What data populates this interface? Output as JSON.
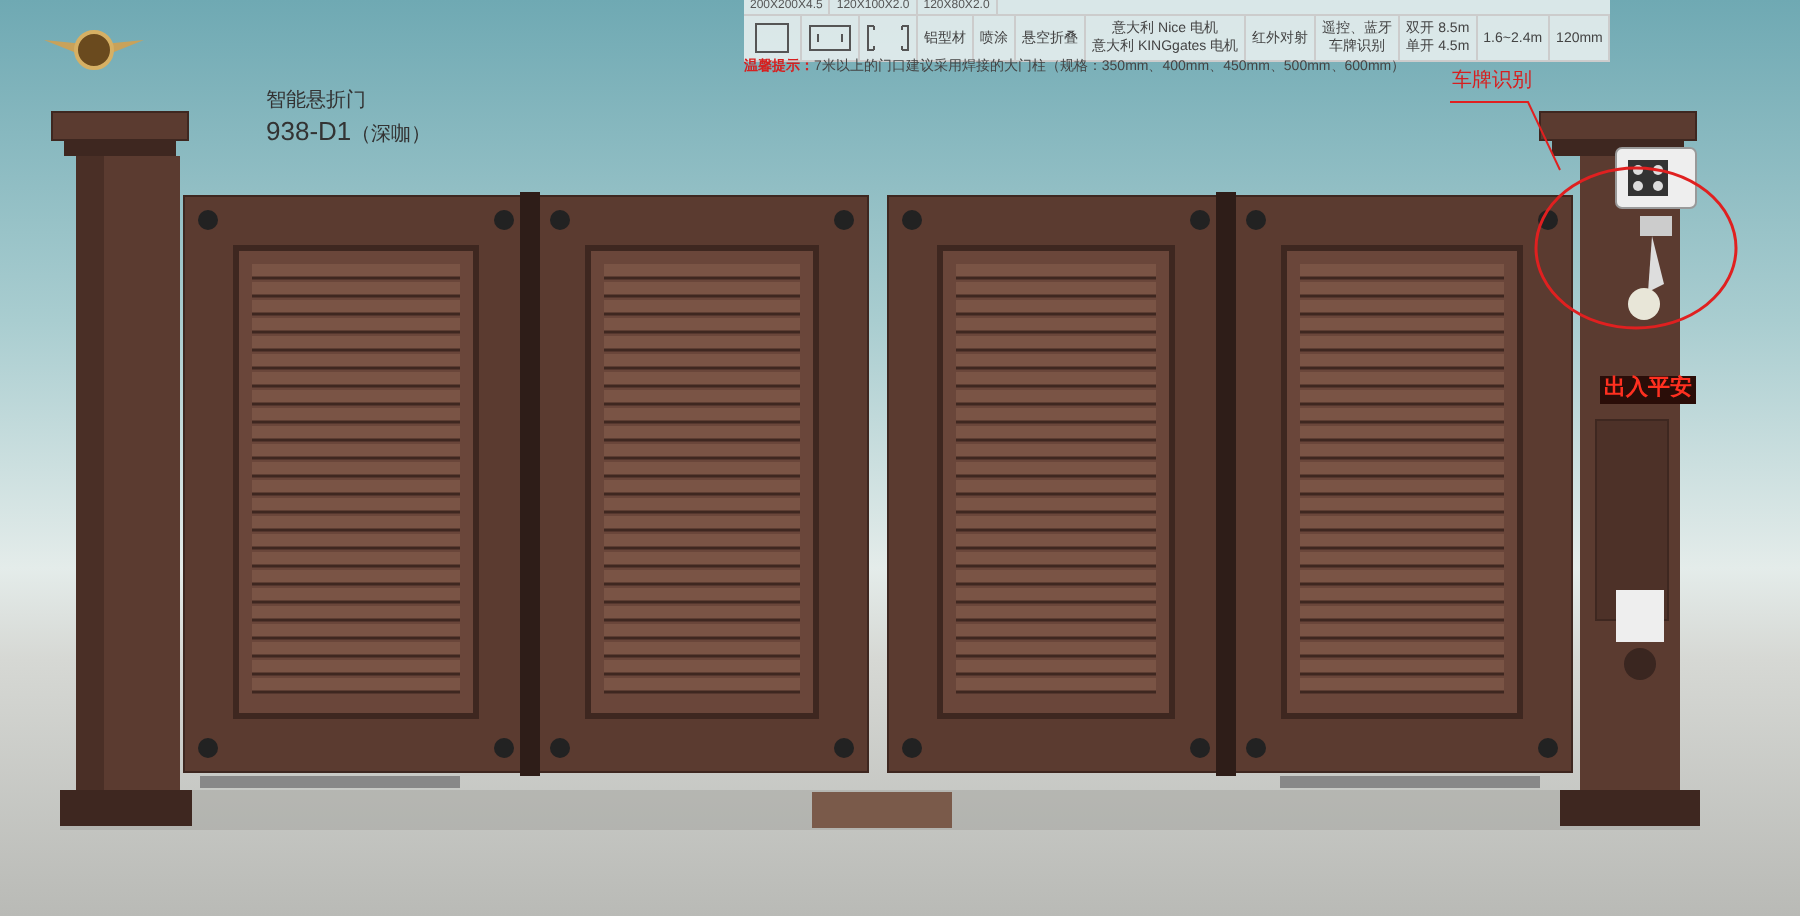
{
  "product": {
    "name": "智能悬折门",
    "model": "938-D1",
    "color_note": "（深咖）"
  },
  "spec_table": {
    "top_cells": [
      "200X200X4.5",
      "120X100X2.0",
      "120X80X2.0"
    ],
    "cells": [
      {
        "kind": "square"
      },
      {
        "kind": "channel"
      },
      {
        "kind": "lipped"
      },
      {
        "kind": "text",
        "lines": [
          "铝型材"
        ]
      },
      {
        "kind": "text",
        "lines": [
          "喷涂"
        ]
      },
      {
        "kind": "text",
        "lines": [
          "悬空折叠"
        ]
      },
      {
        "kind": "text",
        "lines": [
          "意大利 Nice 电机",
          "意大利 KINGgates 电机"
        ]
      },
      {
        "kind": "text",
        "lines": [
          "红外对射"
        ]
      },
      {
        "kind": "text",
        "lines": [
          "遥控、蓝牙",
          "车牌识别"
        ]
      },
      {
        "kind": "text",
        "lines": [
          "双开 8.5m",
          "单开 4.5m"
        ]
      },
      {
        "kind": "text",
        "lines": [
          "1.6~2.4m"
        ]
      },
      {
        "kind": "text",
        "lines": [
          "120mm"
        ]
      }
    ]
  },
  "notice": {
    "label": "温馨提示：",
    "text": "7米以上的门口建议采用焊接的大门柱（规格：350mm、400mm、450mm、500mm、600mm）"
  },
  "callout": {
    "label": "车牌识别"
  },
  "led_sign": {
    "text": "出入平安"
  }
}
